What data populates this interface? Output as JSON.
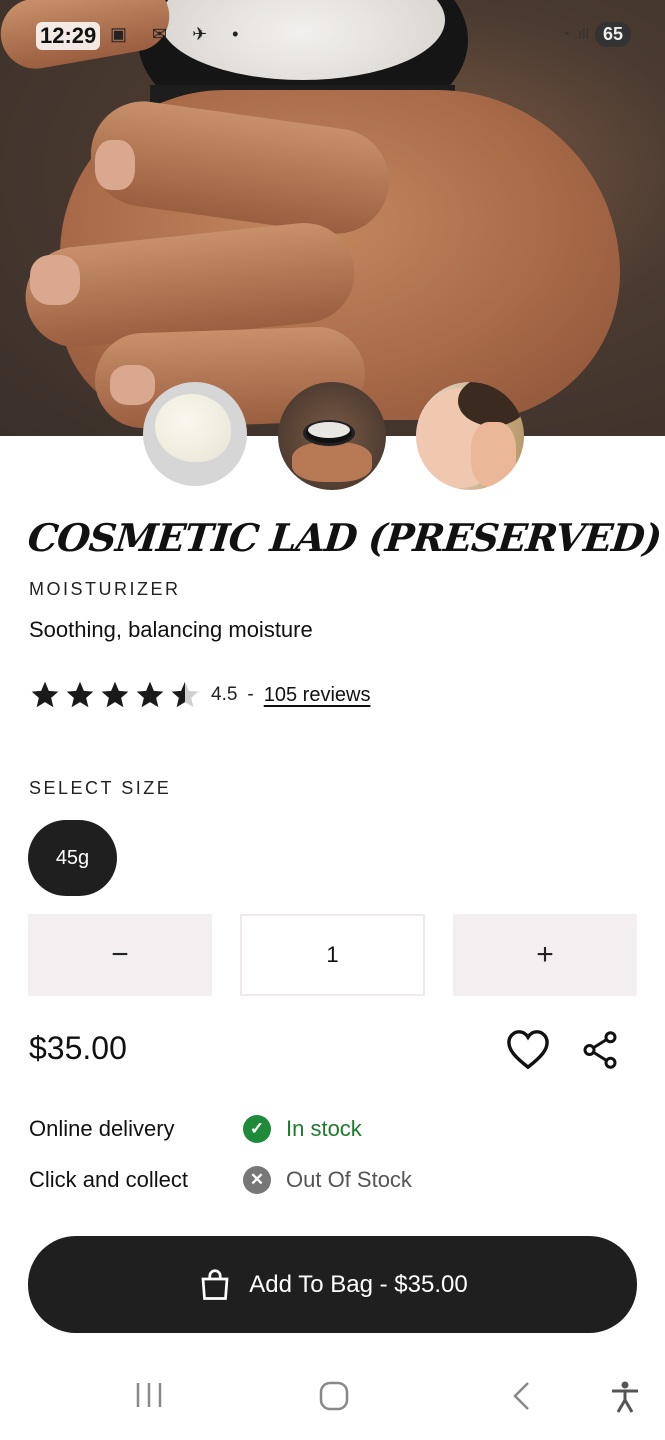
{
  "status_bar": {
    "time": "12:29",
    "battery": "65"
  },
  "product": {
    "title": "COSMETIC LAD (PRESERVED)",
    "category": "MOISTURIZER",
    "subtitle": "Soothing, balancing moisture",
    "rating_value": "4.5",
    "rating_separator": "-",
    "reviews_link": "105 reviews",
    "stars": 4.5
  },
  "size": {
    "label": "SELECT SIZE",
    "selected": "45g"
  },
  "quantity": {
    "minus": "−",
    "value": "1",
    "plus": "+"
  },
  "price": "$35.00",
  "availability": [
    {
      "label": "Online delivery",
      "status": "In stock",
      "icon": "check-circle-icon",
      "color": "#1e7a2c"
    },
    {
      "label": "Click and collect",
      "status": "Out Of Stock",
      "icon": "x-circle-icon",
      "color": "#555555"
    }
  ],
  "add_to_bag": {
    "label": "Add To Bag - $35.00"
  },
  "navbar": {
    "icons": [
      "recent-apps-icon",
      "home-icon",
      "back-icon",
      "accessibility-icon"
    ]
  }
}
